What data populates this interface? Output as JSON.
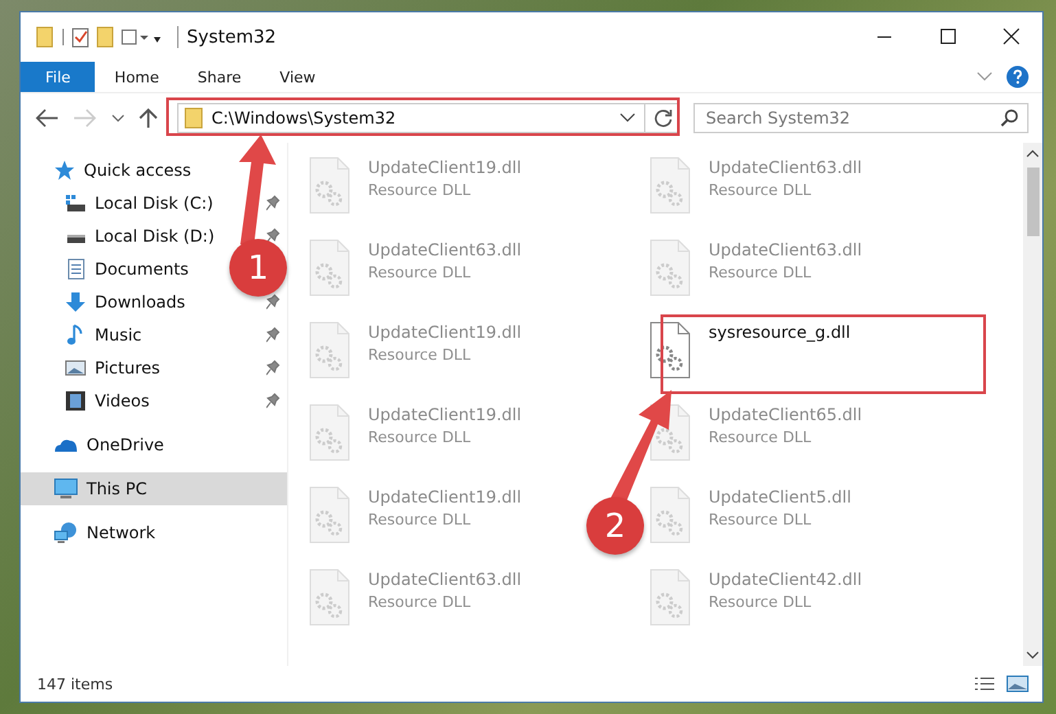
{
  "window": {
    "title": "System32"
  },
  "ribbon_tabs": [
    {
      "label": "File",
      "selected": true
    },
    {
      "label": "Home",
      "selected": false
    },
    {
      "label": "Share",
      "selected": false
    },
    {
      "label": "View",
      "selected": false
    }
  ],
  "address_bar": {
    "value": "C:\\Windows\\System32"
  },
  "search": {
    "placeholder": "Search System32"
  },
  "sidebar": {
    "items": [
      {
        "label": "Quick access",
        "selected": false,
        "children": [
          {
            "label": "Local Disk (C:)",
            "pinned": true
          },
          {
            "label": "Local Disk (D:)",
            "pinned": true
          },
          {
            "label": "Documents",
            "pinned": false
          },
          {
            "label": "Downloads",
            "pinned": true
          },
          {
            "label": "Music",
            "pinned": true
          },
          {
            "label": "Pictures",
            "pinned": true
          },
          {
            "label": "Videos",
            "pinned": true
          }
        ]
      },
      {
        "label": "OneDrive",
        "selected": false
      },
      {
        "label": "This PC",
        "selected": true
      },
      {
        "label": "Network",
        "selected": false
      }
    ]
  },
  "files": [
    {
      "name": "UpdateClient19.dll",
      "type": "Resource DLL",
      "kind": "blurred"
    },
    {
      "name": "UpdateClient63.dll",
      "type": "Resource DLL",
      "kind": "blurred"
    },
    {
      "name": "UpdateClient63.dll",
      "type": "Resource DLL",
      "kind": "blurred"
    },
    {
      "name": "UpdateClient63.dll",
      "type": "Resource DLL",
      "kind": "blurred"
    },
    {
      "name": "UpdateClient19.dll",
      "type": "Resource DLL",
      "kind": "blurred"
    },
    {
      "name": "sysresource_g.dll",
      "kind": "highlighted"
    },
    {
      "name": "UpdateClient19.dll",
      "type": "Resource DLL",
      "kind": "blurred"
    },
    {
      "name": "UpdateClient65.dll",
      "type": "Resource DLL",
      "kind": "blurred"
    },
    {
      "name": "UpdateClient19.dll",
      "type": "Resource DLL",
      "kind": "blurred"
    },
    {
      "name": "UpdateClient5.dll",
      "type": "Resource DLL",
      "kind": "blurred"
    },
    {
      "name": "UpdateClient63.dll",
      "type": "Resource DLL",
      "kind": "blurred"
    },
    {
      "name": "UpdateClient42.dll",
      "type": "Resource DLL",
      "kind": "blurred"
    }
  ],
  "status_bar": {
    "count": "147 items"
  },
  "callouts": [
    {
      "number": "1"
    },
    {
      "number": "2"
    }
  ]
}
